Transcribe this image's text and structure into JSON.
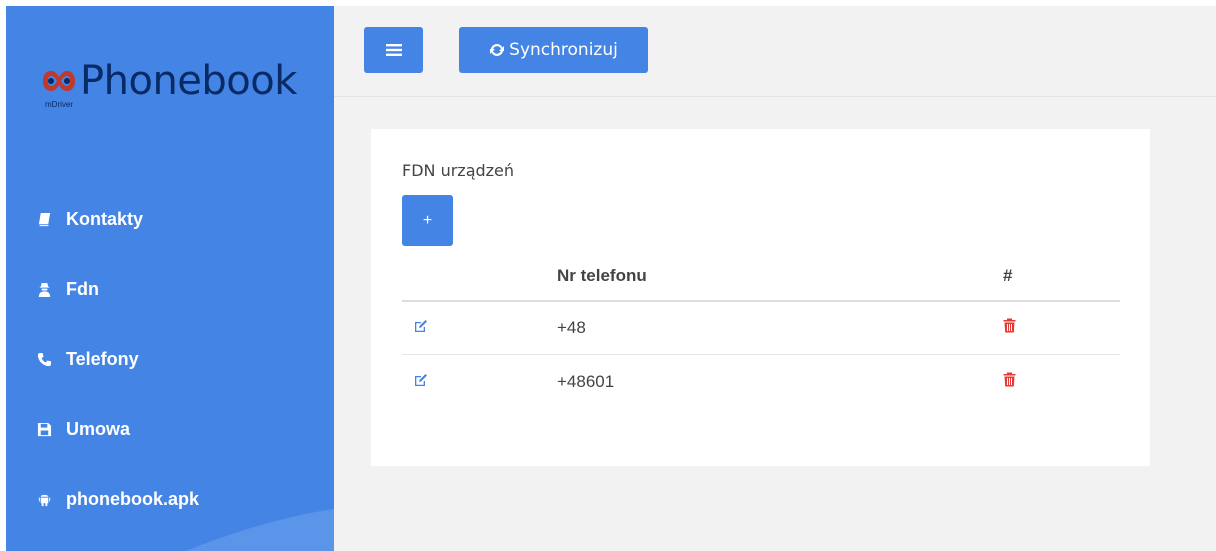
{
  "brand": {
    "name": "Phonebook",
    "sub": "mDriver",
    "color": "#0a2a66"
  },
  "colors": {
    "accent": "#4384e4",
    "danger": "#e53935"
  },
  "sidebar": {
    "items": [
      {
        "label": "Kontakty",
        "icon": "book-icon"
      },
      {
        "label": "Fdn",
        "icon": "user-secret-icon"
      },
      {
        "label": "Telefony",
        "icon": "phone-icon"
      },
      {
        "label": "Umowa",
        "icon": "floppy-icon"
      },
      {
        "label": "phonebook.apk",
        "icon": "android-icon"
      }
    ]
  },
  "topbar": {
    "menu_icon": "bars-icon",
    "sync_label": "Synchronizuj",
    "sync_icon": "refresh-icon"
  },
  "card": {
    "title": "FDN urządzeń",
    "add_label": "+",
    "table": {
      "columns": [
        "",
        "Nr telefonu",
        "#"
      ],
      "rows": [
        {
          "number": "+48"
        },
        {
          "number": "+48601"
        }
      ]
    }
  }
}
